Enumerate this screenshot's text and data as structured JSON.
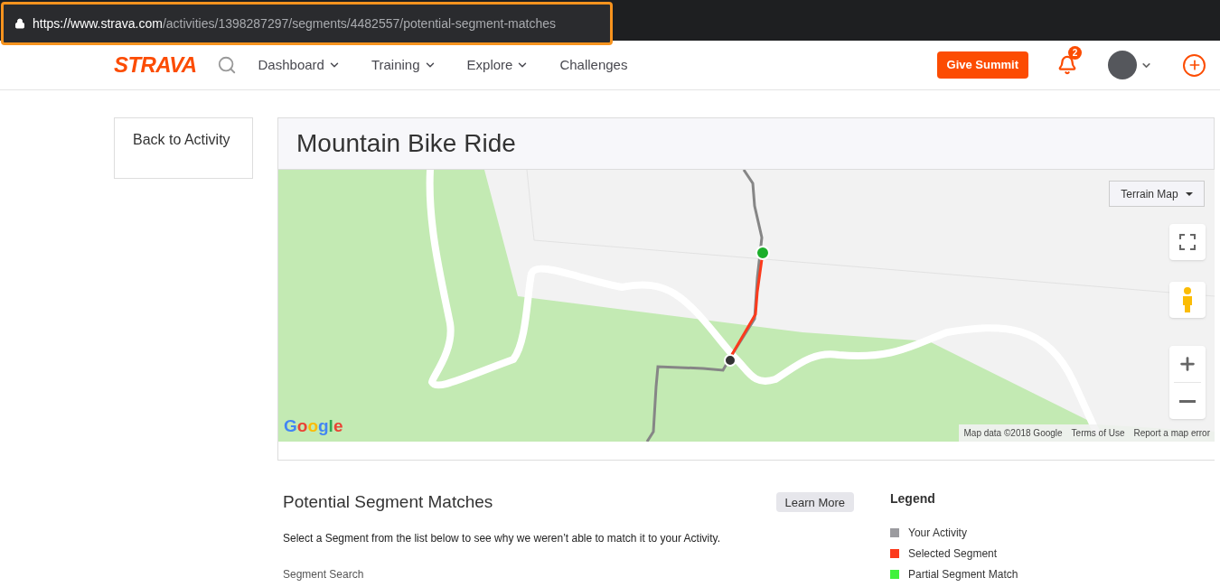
{
  "browser": {
    "url": "**https://www.strava.com**/activities/1398287297/segments/4482557/potential-segment-matches"
  },
  "nav": {
    "logo": "STRAVA",
    "items": [
      {
        "label": "Dashboard",
        "dropdown": true
      },
      {
        "label": "Training",
        "dropdown": true
      },
      {
        "label": "Explore",
        "dropdown": true
      },
      {
        "label": "Challenges",
        "dropdown": false
      }
    ],
    "give_button": "Give Summit",
    "notifications": "2"
  },
  "back_link": "Back to Activity",
  "activity": {
    "title": "Mountain Bike Ride"
  },
  "map": {
    "type_button": "Terrain Map",
    "logo": "Google",
    "attribution": [
      "Map data ©2018 Google",
      "Terms of Use",
      "Report a map error"
    ]
  },
  "matches": {
    "title": "Potential Segment Matches",
    "learn_more": "Learn More",
    "description": "Select a Segment from the list below to see why we weren’t able to match it to your Activity.",
    "search_label": "Segment Search"
  },
  "legend": {
    "title": "Legend",
    "items": [
      {
        "label": "Your Activity",
        "color": "#9b9b9f"
      },
      {
        "label": "Selected Segment",
        "color": "#fc3a1c"
      },
      {
        "label": "Partial Segment Match",
        "color": "#40f23c"
      }
    ]
  }
}
